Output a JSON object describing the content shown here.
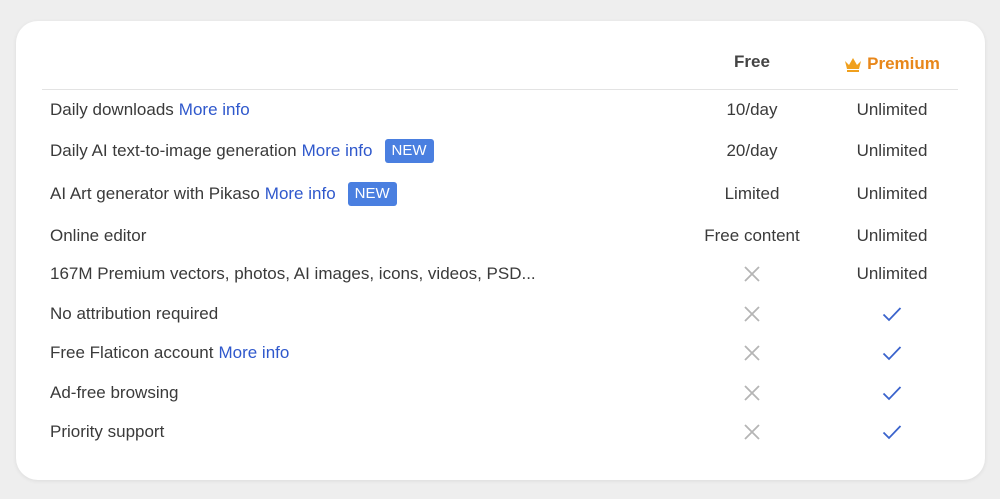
{
  "columns": {
    "free": "Free",
    "premium": "Premium"
  },
  "colors": {
    "link": "#2f58cc",
    "badge": "#4a7fe0",
    "premium": "#e8871a",
    "check": "#3a63cc",
    "cross": "#b5b5b5"
  },
  "rows": [
    {
      "feature": "Daily downloads",
      "link": "More info",
      "badge": "",
      "free": "10/day",
      "premium": "Unlimited"
    },
    {
      "feature": "Daily AI text-to-image generation",
      "link": "More info",
      "badge": "NEW",
      "free": "20/day",
      "premium": "Unlimited"
    },
    {
      "feature": "AI Art generator with Pikaso",
      "link": "More info",
      "badge": "NEW",
      "free": "Limited",
      "premium": "Unlimited"
    },
    {
      "feature": "Online editor",
      "link": "",
      "badge": "",
      "free": "Free content",
      "premium": "Unlimited"
    },
    {
      "feature": "167M Premium vectors, photos, AI images, icons, videos, PSD...",
      "link": "",
      "badge": "",
      "free": "cross-icon",
      "premium": "Unlimited"
    },
    {
      "feature": "No attribution required",
      "link": "",
      "badge": "",
      "free": "cross-icon",
      "premium": "check-icon"
    },
    {
      "feature": "Free Flaticon account",
      "link": "More info",
      "badge": "",
      "free": "cross-icon",
      "premium": "check-icon"
    },
    {
      "feature": "Ad-free browsing",
      "link": "",
      "badge": "",
      "free": "cross-icon",
      "premium": "check-icon"
    },
    {
      "feature": "Priority support",
      "link": "",
      "badge": "",
      "free": "cross-icon",
      "premium": "check-icon"
    }
  ]
}
